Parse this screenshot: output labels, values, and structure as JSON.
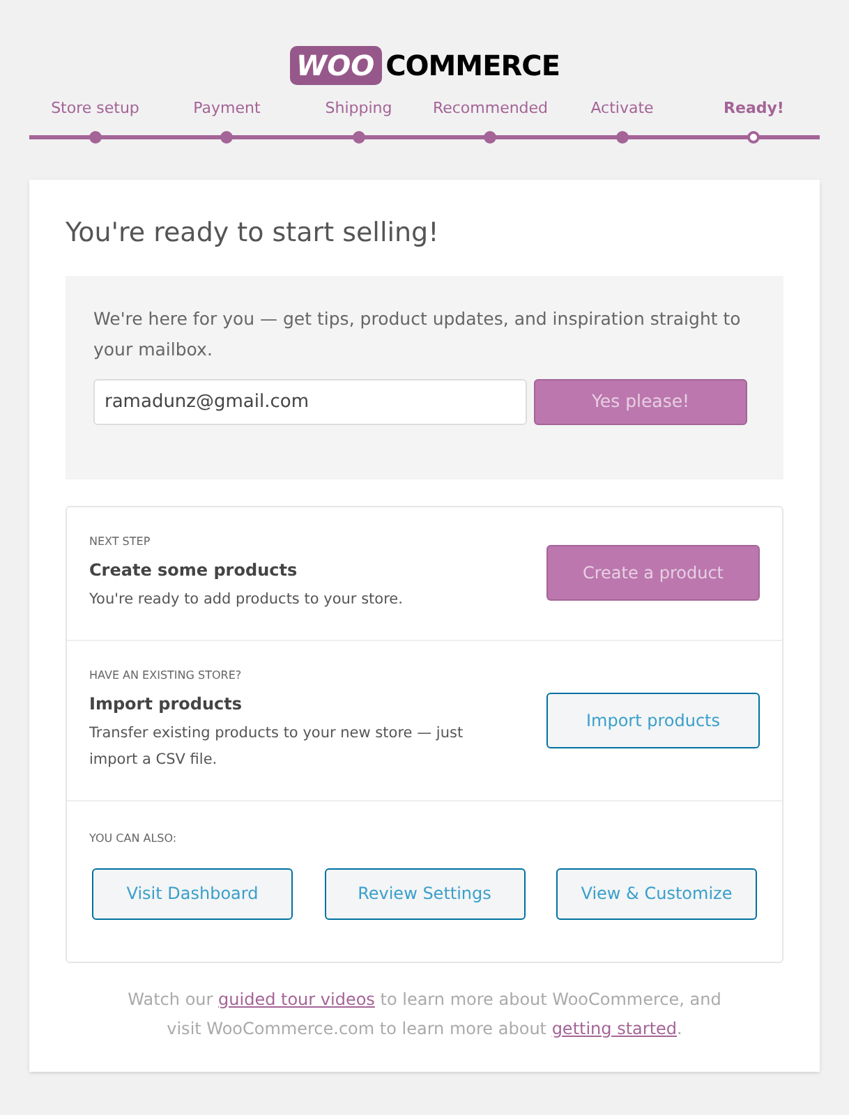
{
  "logo": {
    "badge": "WOO",
    "word": "COMMERCE"
  },
  "steps": [
    {
      "label": "Store setup",
      "selected": false
    },
    {
      "label": "Payment",
      "selected": false
    },
    {
      "label": "Shipping",
      "selected": false
    },
    {
      "label": "Recommended",
      "selected": false
    },
    {
      "label": "Activate",
      "selected": false
    },
    {
      "label": "Ready!",
      "selected": true
    }
  ],
  "title": "You're ready to start selling!",
  "newsletter": {
    "text": "We're here for you — get tips, product updates, and inspiration straight to your mailbox.",
    "email": "ramadunz@gmail.com",
    "button": "Yes please!"
  },
  "sections": [
    {
      "kind": "action",
      "eyebrow": "NEXT STEP",
      "heading": "Create some products",
      "text": "You're ready to add products to your store.",
      "button": "Create a product",
      "primary": true
    },
    {
      "kind": "action",
      "eyebrow": "HAVE AN EXISTING STORE?",
      "heading": "Import products",
      "text": "Transfer existing products to your new store — just import a CSV file.",
      "button": "Import products",
      "primary": false
    },
    {
      "kind": "links",
      "eyebrow": "YOU CAN ALSO:",
      "buttons": [
        "Visit Dashboard",
        "Review Settings",
        "View & Customize"
      ]
    }
  ],
  "footer": [
    {
      "kind": "text",
      "text": "Watch our "
    },
    {
      "kind": "link",
      "text": "guided tour videos"
    },
    {
      "kind": "text",
      "text": " to learn more about WooCommerce, and visit WooCommerce.com to learn more about "
    },
    {
      "kind": "link",
      "text": "getting started"
    },
    {
      "kind": "text",
      "text": "."
    }
  ]
}
